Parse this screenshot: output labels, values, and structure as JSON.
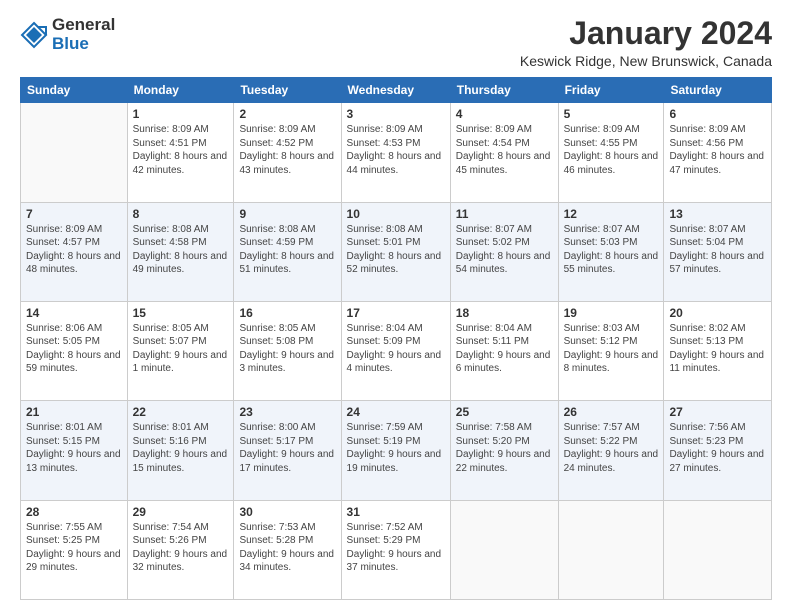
{
  "logo": {
    "general": "General",
    "blue": "Blue"
  },
  "header": {
    "title": "January 2024",
    "location": "Keswick Ridge, New Brunswick, Canada"
  },
  "days_of_week": [
    "Sunday",
    "Monday",
    "Tuesday",
    "Wednesday",
    "Thursday",
    "Friday",
    "Saturday"
  ],
  "weeks": [
    [
      {
        "day": "",
        "sunrise": "",
        "sunset": "",
        "daylight": ""
      },
      {
        "day": "1",
        "sunrise": "Sunrise: 8:09 AM",
        "sunset": "Sunset: 4:51 PM",
        "daylight": "Daylight: 8 hours and 42 minutes."
      },
      {
        "day": "2",
        "sunrise": "Sunrise: 8:09 AM",
        "sunset": "Sunset: 4:52 PM",
        "daylight": "Daylight: 8 hours and 43 minutes."
      },
      {
        "day": "3",
        "sunrise": "Sunrise: 8:09 AM",
        "sunset": "Sunset: 4:53 PM",
        "daylight": "Daylight: 8 hours and 44 minutes."
      },
      {
        "day": "4",
        "sunrise": "Sunrise: 8:09 AM",
        "sunset": "Sunset: 4:54 PM",
        "daylight": "Daylight: 8 hours and 45 minutes."
      },
      {
        "day": "5",
        "sunrise": "Sunrise: 8:09 AM",
        "sunset": "Sunset: 4:55 PM",
        "daylight": "Daylight: 8 hours and 46 minutes."
      },
      {
        "day": "6",
        "sunrise": "Sunrise: 8:09 AM",
        "sunset": "Sunset: 4:56 PM",
        "daylight": "Daylight: 8 hours and 47 minutes."
      }
    ],
    [
      {
        "day": "7",
        "sunrise": "Sunrise: 8:09 AM",
        "sunset": "Sunset: 4:57 PM",
        "daylight": "Daylight: 8 hours and 48 minutes."
      },
      {
        "day": "8",
        "sunrise": "Sunrise: 8:08 AM",
        "sunset": "Sunset: 4:58 PM",
        "daylight": "Daylight: 8 hours and 49 minutes."
      },
      {
        "day": "9",
        "sunrise": "Sunrise: 8:08 AM",
        "sunset": "Sunset: 4:59 PM",
        "daylight": "Daylight: 8 hours and 51 minutes."
      },
      {
        "day": "10",
        "sunrise": "Sunrise: 8:08 AM",
        "sunset": "Sunset: 5:01 PM",
        "daylight": "Daylight: 8 hours and 52 minutes."
      },
      {
        "day": "11",
        "sunrise": "Sunrise: 8:07 AM",
        "sunset": "Sunset: 5:02 PM",
        "daylight": "Daylight: 8 hours and 54 minutes."
      },
      {
        "day": "12",
        "sunrise": "Sunrise: 8:07 AM",
        "sunset": "Sunset: 5:03 PM",
        "daylight": "Daylight: 8 hours and 55 minutes."
      },
      {
        "day": "13",
        "sunrise": "Sunrise: 8:07 AM",
        "sunset": "Sunset: 5:04 PM",
        "daylight": "Daylight: 8 hours and 57 minutes."
      }
    ],
    [
      {
        "day": "14",
        "sunrise": "Sunrise: 8:06 AM",
        "sunset": "Sunset: 5:05 PM",
        "daylight": "Daylight: 8 hours and 59 minutes."
      },
      {
        "day": "15",
        "sunrise": "Sunrise: 8:05 AM",
        "sunset": "Sunset: 5:07 PM",
        "daylight": "Daylight: 9 hours and 1 minute."
      },
      {
        "day": "16",
        "sunrise": "Sunrise: 8:05 AM",
        "sunset": "Sunset: 5:08 PM",
        "daylight": "Daylight: 9 hours and 3 minutes."
      },
      {
        "day": "17",
        "sunrise": "Sunrise: 8:04 AM",
        "sunset": "Sunset: 5:09 PM",
        "daylight": "Daylight: 9 hours and 4 minutes."
      },
      {
        "day": "18",
        "sunrise": "Sunrise: 8:04 AM",
        "sunset": "Sunset: 5:11 PM",
        "daylight": "Daylight: 9 hours and 6 minutes."
      },
      {
        "day": "19",
        "sunrise": "Sunrise: 8:03 AM",
        "sunset": "Sunset: 5:12 PM",
        "daylight": "Daylight: 9 hours and 8 minutes."
      },
      {
        "day": "20",
        "sunrise": "Sunrise: 8:02 AM",
        "sunset": "Sunset: 5:13 PM",
        "daylight": "Daylight: 9 hours and 11 minutes."
      }
    ],
    [
      {
        "day": "21",
        "sunrise": "Sunrise: 8:01 AM",
        "sunset": "Sunset: 5:15 PM",
        "daylight": "Daylight: 9 hours and 13 minutes."
      },
      {
        "day": "22",
        "sunrise": "Sunrise: 8:01 AM",
        "sunset": "Sunset: 5:16 PM",
        "daylight": "Daylight: 9 hours and 15 minutes."
      },
      {
        "day": "23",
        "sunrise": "Sunrise: 8:00 AM",
        "sunset": "Sunset: 5:17 PM",
        "daylight": "Daylight: 9 hours and 17 minutes."
      },
      {
        "day": "24",
        "sunrise": "Sunrise: 7:59 AM",
        "sunset": "Sunset: 5:19 PM",
        "daylight": "Daylight: 9 hours and 19 minutes."
      },
      {
        "day": "25",
        "sunrise": "Sunrise: 7:58 AM",
        "sunset": "Sunset: 5:20 PM",
        "daylight": "Daylight: 9 hours and 22 minutes."
      },
      {
        "day": "26",
        "sunrise": "Sunrise: 7:57 AM",
        "sunset": "Sunset: 5:22 PM",
        "daylight": "Daylight: 9 hours and 24 minutes."
      },
      {
        "day": "27",
        "sunrise": "Sunrise: 7:56 AM",
        "sunset": "Sunset: 5:23 PM",
        "daylight": "Daylight: 9 hours and 27 minutes."
      }
    ],
    [
      {
        "day": "28",
        "sunrise": "Sunrise: 7:55 AM",
        "sunset": "Sunset: 5:25 PM",
        "daylight": "Daylight: 9 hours and 29 minutes."
      },
      {
        "day": "29",
        "sunrise": "Sunrise: 7:54 AM",
        "sunset": "Sunset: 5:26 PM",
        "daylight": "Daylight: 9 hours and 32 minutes."
      },
      {
        "day": "30",
        "sunrise": "Sunrise: 7:53 AM",
        "sunset": "Sunset: 5:28 PM",
        "daylight": "Daylight: 9 hours and 34 minutes."
      },
      {
        "day": "31",
        "sunrise": "Sunrise: 7:52 AM",
        "sunset": "Sunset: 5:29 PM",
        "daylight": "Daylight: 9 hours and 37 minutes."
      },
      {
        "day": "",
        "sunrise": "",
        "sunset": "",
        "daylight": ""
      },
      {
        "day": "",
        "sunrise": "",
        "sunset": "",
        "daylight": ""
      },
      {
        "day": "",
        "sunrise": "",
        "sunset": "",
        "daylight": ""
      }
    ]
  ]
}
